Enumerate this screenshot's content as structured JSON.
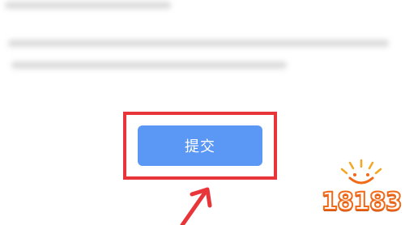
{
  "form": {
    "submit_label": "提交"
  },
  "watermark": {
    "logo_text": "18183"
  },
  "colors": {
    "button": "#5b97f4",
    "highlight": "#e8353a",
    "logo_orange": "#f06a1a"
  },
  "icons": [
    "arrow-up-icon",
    "logo-18183"
  ]
}
